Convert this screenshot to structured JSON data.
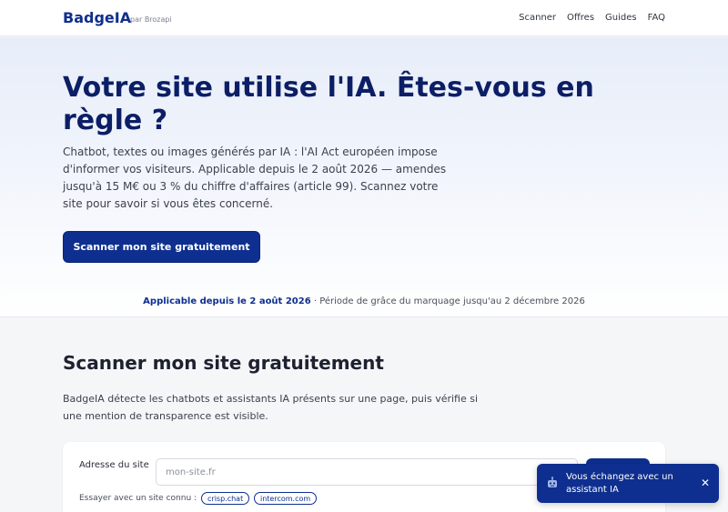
{
  "header": {
    "brand": "BadgeIA",
    "brand_sub": "par Brozapi",
    "nav": [
      "Scanner",
      "Offres",
      "Guides",
      "FAQ"
    ]
  },
  "hero": {
    "title": "Votre site utilise l'IA. Êtes-vous en règle ?",
    "text": "Chatbot, textes ou images générés par IA : l'AI Act européen impose d'informer vos visiteurs. Applicable depuis le 2 août 2026 — amendes jusqu'à 15 M€ ou 3 % du chiffre d'affaires (article 99). Scannez votre site pour savoir si vous êtes concerné.",
    "cta_label": "Scanner mon site gratuitement",
    "notice_strong": "Applicable depuis le 2 août 2026",
    "notice_rest": " · Période de grâce du marquage jusqu'au 2 décembre 2026"
  },
  "scanner": {
    "title": "Scanner mon site gratuitement",
    "text": "BadgeIA détecte les chatbots et assistants IA présents sur une page, puis vérifie si une mention de transparence est visible.",
    "field_label": "Adresse du site",
    "input_placeholder": "mon-site.fr",
    "try_label": "Essayer avec un site connu :",
    "examples": [
      "crisp.chat",
      "intercom.com"
    ]
  },
  "toast": {
    "icon": "robot-icon",
    "text": "Vous échangez avec un assistant IA",
    "close": "✕"
  },
  "colors": {
    "primary": "#0e2f8f",
    "title": "#0c1e66"
  }
}
